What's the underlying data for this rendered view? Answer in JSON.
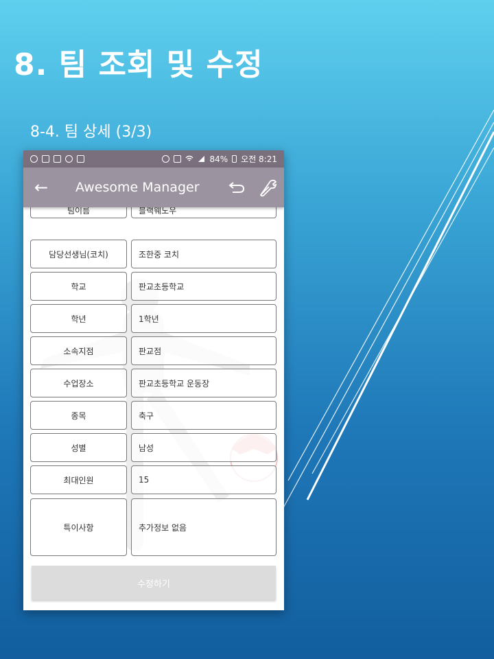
{
  "slide": {
    "title": "8. 팀 조회 및 수정",
    "subtitle": "8-4. 팀 상세 (3/3)"
  },
  "status_bar": {
    "left_icons": [
      "g-icon",
      "v-icon",
      "image-icon",
      "eye-icon",
      "bag-icon"
    ],
    "right_icons": [
      "alarm-icon",
      "hd-icon",
      "wifi-icon",
      "signal-icon",
      "battery-icon"
    ],
    "battery": "84%",
    "time": "오전 8:21"
  },
  "app_bar": {
    "title": "Awesome Manager",
    "back_icon": "arrow-left-icon",
    "undo_icon": "undo-icon",
    "settings_icon": "wrench-icon"
  },
  "form": {
    "rows": [
      {
        "label": "팀이름",
        "value": "블랙웨노우"
      },
      {
        "label": "담당선생님(코치)",
        "value": "조한중 코치"
      },
      {
        "label": "학교",
        "value": "판교초등학교"
      },
      {
        "label": "학년",
        "value": "1학년"
      },
      {
        "label": "소속지점",
        "value": "판교점"
      },
      {
        "label": "수업장소",
        "value": "판교초등학교 운동장"
      },
      {
        "label": "종목",
        "value": "축구"
      },
      {
        "label": "성별",
        "value": "남성"
      },
      {
        "label": "최대인원",
        "value": "15"
      },
      {
        "label": "특이사항",
        "value": "추가정보 없음"
      }
    ],
    "submit_label": "수정하기"
  },
  "colors": {
    "status_bar": "#7a6f7c",
    "app_bar": "#9c93a0",
    "cell_border": "#777777",
    "submit_bg": "#dcdcdc"
  }
}
